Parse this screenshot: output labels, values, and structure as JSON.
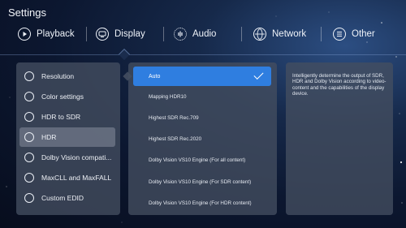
{
  "header": {
    "title": "Settings"
  },
  "tabs": [
    {
      "label": "Playback",
      "icon": "play-circle-icon"
    },
    {
      "label": "Display",
      "icon": "display-icon"
    },
    {
      "label": "Audio",
      "icon": "audio-icon"
    },
    {
      "label": "Network",
      "icon": "globe-icon"
    },
    {
      "label": "Other",
      "icon": "menu-circle-icon"
    }
  ],
  "menu": {
    "items": [
      {
        "label": "Resolution",
        "icon": "resolution-icon"
      },
      {
        "label": "Color settings",
        "icon": "palette-icon"
      },
      {
        "label": "HDR to SDR",
        "icon": "hdr-to-sdr-icon"
      },
      {
        "label": "HDR",
        "icon": "hdr-icon"
      },
      {
        "label": "Dolby Vision compati...",
        "icon": "dolby-vision-icon"
      },
      {
        "label": "MaxCLL and MaxFALL",
        "icon": "maxcll-icon"
      },
      {
        "label": "Custom EDID",
        "icon": "edid-icon"
      }
    ],
    "active_index": 3
  },
  "options": {
    "items": [
      "Auto",
      "Mapping HDR10",
      "Highest SDR Rec.709",
      "Highest SDR Rec.2020",
      "Dolby Vision VS10 Engine (For all content)",
      "Dolby Vision VS10 Engine (For SDR content)",
      "Dolby Vision VS10 Engine (For HDR content)"
    ],
    "selected_index": 0
  },
  "description": "Intelligently determine the output of SDR, HDR and Dolby Vision according to video-content and the capabilities of the display device.",
  "colors": {
    "accent": "#2f7ee0",
    "panel": "#444e60",
    "background": "#0c1730"
  }
}
